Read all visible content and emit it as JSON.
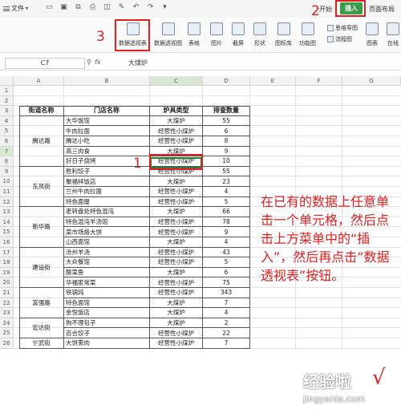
{
  "menubar": {
    "file_label": "文件",
    "tabs": [
      "开始",
      "插入",
      "页面布局"
    ],
    "active_tab": "插入"
  },
  "ribbon": {
    "buttons": [
      "数据透视表",
      "数据透视图",
      "表格",
      "图片",
      "截屏",
      "形状",
      "图标库",
      "功能图",
      "思维导图",
      "流程图",
      "图表",
      "在线"
    ]
  },
  "formula_bar": {
    "cell_ref": "C7",
    "fx": "fx",
    "value": "大煤炉"
  },
  "grid": {
    "columns": [
      "A",
      "B",
      "C",
      "D",
      "E",
      "F",
      "G"
    ],
    "rows": [
      "1",
      "2",
      "3",
      "4",
      "5",
      "6",
      "7",
      "8",
      "9",
      "10",
      "11",
      "12",
      "13",
      "14",
      "15",
      "16",
      "17",
      "18",
      "19",
      "20",
      "21",
      "22",
      "23",
      "24",
      "25",
      "26"
    ],
    "selected_row": "7",
    "selected_col": "C"
  },
  "table": {
    "headers": [
      "街道名称",
      "门店名称",
      "炉具类型",
      "排查数量"
    ],
    "groups": [
      {
        "street": "腾达路",
        "rows": [
          [
            "大华饭馆",
            "大煤炉",
            "55"
          ],
          [
            "牛肉拉面",
            "经营性小煤炉",
            "6"
          ],
          [
            "腾达小吃",
            "经营性小煤炉",
            "8"
          ],
          [
            "高三肉食",
            "大煤炉",
            "9"
          ],
          [
            "好日子烧烤",
            "经营性小煤炉",
            "10"
          ]
        ]
      },
      {
        "street": "东风街",
        "rows": [
          [
            "胜利饺子",
            "经营性小煤炉",
            "55"
          ],
          [
            "聚福祥饭店",
            "大煤炉",
            "23"
          ],
          [
            "兰州牛肉拉面",
            "经营性小煤炉",
            "4"
          ],
          [
            "特色面屋",
            "经营性小煤炉",
            "5"
          ]
        ]
      },
      {
        "street": "新华路",
        "rows": [
          [
            "老转盘处特色混沌",
            "大煤炉",
            "66"
          ],
          [
            "特色混沌羊汤馆",
            "经营性小煤炉",
            "78"
          ],
          [
            "菜市场烙大饼",
            "经营性小煤炉",
            "9"
          ],
          [
            "山西面馆",
            "大煤炉",
            "4"
          ]
        ]
      },
      {
        "street": "建设街",
        "rows": [
          [
            "沧州羊汤",
            "经营性小煤炉",
            "43"
          ],
          [
            "大众餐馆",
            "经营性小煤炉",
            "5"
          ],
          [
            "酸菜鱼",
            "大煤炉",
            "6"
          ],
          [
            "华福家常菜",
            "经营性小煤炉",
            "75"
          ]
        ]
      },
      {
        "street": "富强路",
        "rows": [
          [
            "铁锅炖",
            "经营性小煤炉",
            "343"
          ],
          [
            "特色面馆",
            "大煤炉",
            "7"
          ],
          [
            "金悦饭店",
            "大煤炉",
            "4"
          ]
        ]
      },
      {
        "street": "宏达街",
        "rows": [
          [
            "狗不理包子",
            "大煤炉",
            "2"
          ],
          [
            "百合饺子",
            "经营性小煤炉",
            "22"
          ]
        ]
      },
      {
        "street": "宁武街",
        "rows": [
          [
            "大饼熏肉",
            "经营性小煤炉",
            "7"
          ]
        ]
      }
    ]
  },
  "annotations": {
    "step1": "1",
    "step2": "2",
    "step3": "3",
    "instruction": "在已有的数据上任意单击一个单元格，然后点击上方菜单中的“插入”，然后再点击“数据透视表”按钮。"
  },
  "watermark": {
    "text": "经验啦",
    "check": "√",
    "url": "jingyanla.com"
  },
  "colors": {
    "accent_green": "#3a9b4a",
    "annotation_red": "#e02020"
  }
}
